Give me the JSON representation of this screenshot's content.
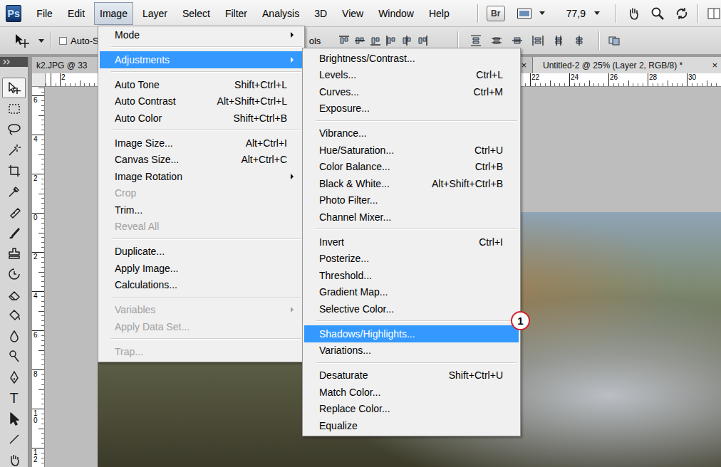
{
  "app": {
    "logo": "Ps"
  },
  "menubar": [
    {
      "label": "File",
      "selected": false
    },
    {
      "label": "Edit",
      "selected": false
    },
    {
      "label": "Image",
      "selected": true
    },
    {
      "label": "Layer",
      "selected": false
    },
    {
      "label": "Select",
      "selected": false
    },
    {
      "label": "Filter",
      "selected": false
    },
    {
      "label": "Analysis",
      "selected": false
    },
    {
      "label": "3D",
      "selected": false
    },
    {
      "label": "View",
      "selected": false
    },
    {
      "label": "Window",
      "selected": false
    },
    {
      "label": "Help",
      "selected": false
    }
  ],
  "application_bar": {
    "bridge_button": "Br",
    "zoom": "77,9"
  },
  "options_bar": {
    "auto_select": {
      "label": "Auto-S",
      "checked": false
    },
    "transform_controls_label": "ols"
  },
  "tools": [
    {
      "selected": true
    },
    {
      "selected": false
    },
    {
      "selected": false
    },
    {
      "selected": false
    },
    {
      "selected": false
    },
    {
      "selected": false
    },
    {
      "selected": false
    },
    {
      "selected": false
    },
    {
      "selected": false
    },
    {
      "selected": false
    },
    {
      "selected": false
    },
    {
      "selected": false
    },
    {
      "selected": false
    },
    {
      "selected": false
    },
    {
      "selected": false
    },
    {
      "selected": false,
      "glyph": "T"
    },
    {
      "selected": false
    },
    {
      "selected": false
    },
    {
      "selected": false
    }
  ],
  "tabs": [
    {
      "label": "k2.JPG @ 33",
      "close": "×",
      "selected": false
    },
    {
      "label": "Untitled-2 @ 25% (Layer 2, RGB/8) *",
      "close": "×",
      "selected": true
    }
  ],
  "rulers": {
    "horizontal": [
      "2",
      "22",
      "24",
      "26",
      "28",
      "30"
    ],
    "vertical": [
      "6",
      "4",
      "2",
      "0",
      "2",
      "4",
      "6",
      "8",
      "10",
      "12"
    ]
  },
  "image_menu": {
    "groups": [
      [
        {
          "label": "Mode",
          "submenu": true,
          "disabled": false,
          "selected": false
        }
      ],
      [
        {
          "label": "Adjustments",
          "submenu": true,
          "disabled": false,
          "selected": true
        }
      ],
      [
        {
          "label": "Auto Tone",
          "shortcut": "Shift+Ctrl+L",
          "submenu": false,
          "disabled": false,
          "selected": false
        },
        {
          "label": "Auto Contrast",
          "shortcut": "Alt+Shift+Ctrl+L",
          "submenu": false,
          "disabled": false,
          "selected": false
        },
        {
          "label": "Auto Color",
          "shortcut": "Shift+Ctrl+B",
          "submenu": false,
          "disabled": false,
          "selected": false
        }
      ],
      [
        {
          "label": "Image Size...",
          "shortcut": "Alt+Ctrl+I",
          "submenu": false,
          "disabled": false,
          "selected": false
        },
        {
          "label": "Canvas Size...",
          "shortcut": "Alt+Ctrl+C",
          "submenu": false,
          "disabled": false,
          "selected": false
        },
        {
          "label": "Image Rotation",
          "submenu": true,
          "disabled": false,
          "selected": false
        },
        {
          "label": "Crop",
          "submenu": false,
          "disabled": true,
          "selected": false
        },
        {
          "label": "Trim...",
          "submenu": false,
          "disabled": false,
          "selected": false
        },
        {
          "label": "Reveal All",
          "submenu": false,
          "disabled": true,
          "selected": false
        }
      ],
      [
        {
          "label": "Duplicate...",
          "submenu": false,
          "disabled": false,
          "selected": false
        },
        {
          "label": "Apply Image...",
          "submenu": false,
          "disabled": false,
          "selected": false
        },
        {
          "label": "Calculations...",
          "submenu": false,
          "disabled": false,
          "selected": false
        }
      ],
      [
        {
          "label": "Variables",
          "submenu": true,
          "disabled": true,
          "selected": false
        },
        {
          "label": "Apply Data Set...",
          "submenu": false,
          "disabled": true,
          "selected": false
        }
      ],
      [
        {
          "label": "Trap...",
          "submenu": false,
          "disabled": true,
          "selected": false
        }
      ]
    ]
  },
  "adjustments_menu": {
    "groups": [
      [
        {
          "label": "Brightness/Contrast...",
          "disabled": false,
          "selected": false
        },
        {
          "label": "Levels...",
          "shortcut": "Ctrl+L",
          "disabled": false,
          "selected": false
        },
        {
          "label": "Curves...",
          "shortcut": "Ctrl+M",
          "disabled": false,
          "selected": false
        },
        {
          "label": "Exposure...",
          "disabled": false,
          "selected": false
        }
      ],
      [
        {
          "label": "Vibrance...",
          "disabled": false,
          "selected": false
        },
        {
          "label": "Hue/Saturation...",
          "shortcut": "Ctrl+U",
          "disabled": false,
          "selected": false
        },
        {
          "label": "Color Balance...",
          "shortcut": "Ctrl+B",
          "disabled": false,
          "selected": false
        },
        {
          "label": "Black & White...",
          "shortcut": "Alt+Shift+Ctrl+B",
          "disabled": false,
          "selected": false
        },
        {
          "label": "Photo Filter...",
          "disabled": false,
          "selected": false
        },
        {
          "label": "Channel Mixer...",
          "disabled": false,
          "selected": false
        }
      ],
      [
        {
          "label": "Invert",
          "shortcut": "Ctrl+I",
          "disabled": false,
          "selected": false
        },
        {
          "label": "Posterize...",
          "disabled": false,
          "selected": false
        },
        {
          "label": "Threshold...",
          "disabled": false,
          "selected": false
        },
        {
          "label": "Gradient Map...",
          "disabled": false,
          "selected": false
        },
        {
          "label": "Selective Color...",
          "disabled": false,
          "selected": false
        }
      ],
      [
        {
          "label": "Shadows/Highlights...",
          "disabled": false,
          "selected": true
        },
        {
          "label": "Variations...",
          "disabled": false,
          "selected": false
        }
      ],
      [
        {
          "label": "Desaturate",
          "shortcut": "Shift+Ctrl+U",
          "disabled": false,
          "selected": false
        },
        {
          "label": "Match Color...",
          "disabled": false,
          "selected": false
        },
        {
          "label": "Replace Color...",
          "disabled": false,
          "selected": false
        },
        {
          "label": "Equalize",
          "disabled": false,
          "selected": false
        }
      ]
    ]
  },
  "badge": {
    "label": "1"
  }
}
